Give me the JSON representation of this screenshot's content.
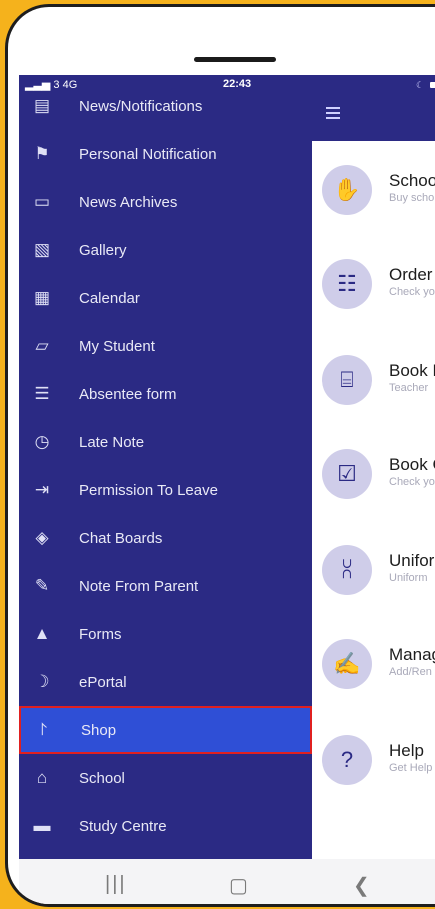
{
  "status": {
    "signal": "▂▃▅ 3  4G",
    "time": "22:43"
  },
  "drawer": {
    "items": [
      {
        "label": "News/Notifications",
        "icon": "news-icon"
      },
      {
        "label": "Personal Notification",
        "icon": "bell-icon"
      },
      {
        "label": "News Archives",
        "icon": "folder-icon"
      },
      {
        "label": "Gallery",
        "icon": "image-icon"
      },
      {
        "label": "Calendar",
        "icon": "calendar-icon"
      },
      {
        "label": "My Student",
        "icon": "student-icon"
      },
      {
        "label": "Absentee form",
        "icon": "form-icon"
      },
      {
        "label": "Late Note",
        "icon": "clock-icon"
      },
      {
        "label": "Permission To Leave",
        "icon": "exit-icon"
      },
      {
        "label": "Chat Boards",
        "icon": "chat-icon"
      },
      {
        "label": "Note From Parent",
        "icon": "note-icon"
      },
      {
        "label": "Forms",
        "icon": "forms-icon"
      },
      {
        "label": "ePortal",
        "icon": "portal-icon"
      },
      {
        "label": "Shop",
        "icon": "cart-icon",
        "active": true
      },
      {
        "label": "School",
        "icon": "school-icon"
      },
      {
        "label": "Study Centre",
        "icon": "study-icon"
      }
    ]
  },
  "shop_list": [
    {
      "title": "Schoo",
      "subtitle": "Buy scho",
      "icon": "hand-card-icon"
    },
    {
      "title": "Order",
      "subtitle": "Check yo",
      "icon": "receipt-icon"
    },
    {
      "title": "Book L",
      "subtitle": "Teacher",
      "icon": "book-icon"
    },
    {
      "title": "Book C",
      "subtitle": "Check yo",
      "icon": "book-check-icon"
    },
    {
      "title": "Unifor",
      "subtitle": "Uniform",
      "icon": "shirt-icon"
    },
    {
      "title": "Manag",
      "subtitle": "Add/Ren",
      "icon": "card-hand-icon"
    },
    {
      "title": "Help",
      "subtitle": "Get Help",
      "icon": "help-icon"
    }
  ],
  "colors": {
    "drawer_bg": "#2b2a84",
    "active_bg": "#2f4fd6",
    "highlight_border": "#e02020",
    "frame": "#f5b21c"
  }
}
